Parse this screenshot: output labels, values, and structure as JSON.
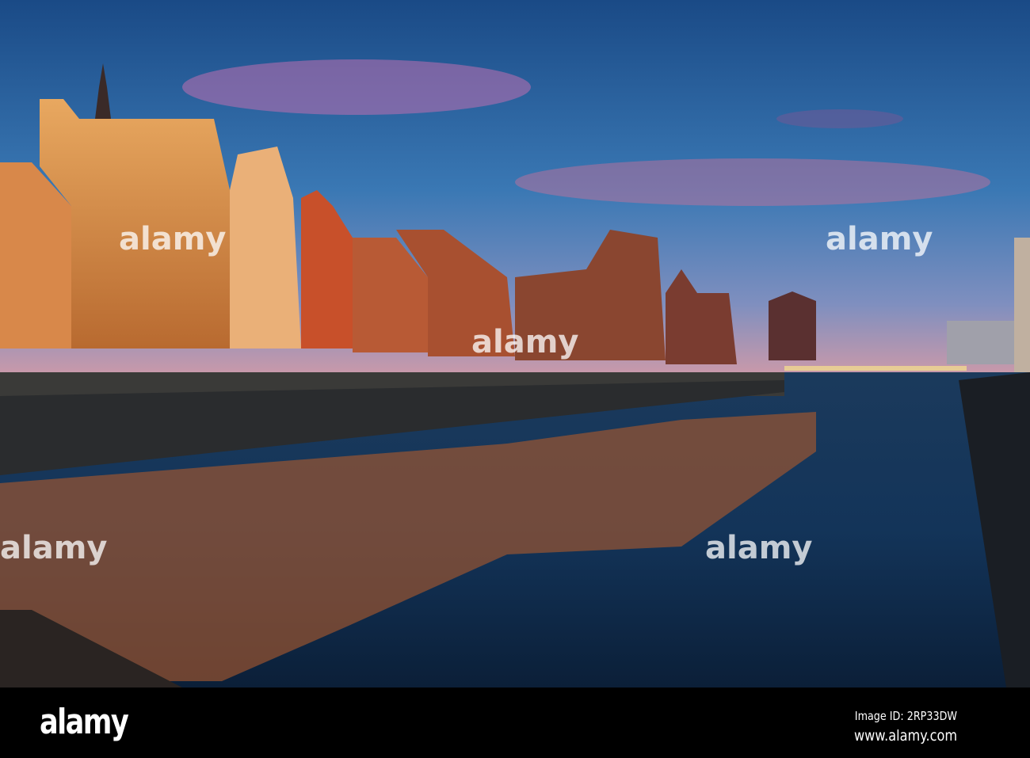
{
  "photo": {
    "subject": "Motlawa riverside at dusk",
    "watermark_text": "alamy",
    "colors": {
      "sky_top": "#1d4f8a",
      "sky_mid": "#3b72b0",
      "sunset": "#c86a9a",
      "water": "#0d2440",
      "lights": "#f2a640"
    }
  },
  "footer": {
    "logo": "alamy",
    "image_id": "Image ID: 2RP33DW",
    "website": "www.alamy.com"
  }
}
